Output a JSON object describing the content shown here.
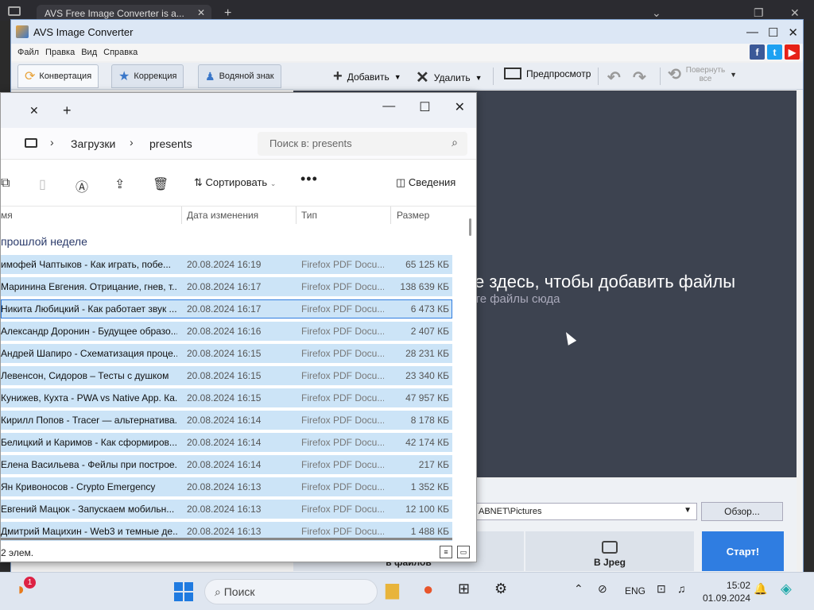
{
  "browser": {
    "tab_title": "AVS Free Image Converter is a...",
    "tab_close": "✕",
    "new_tab": "+",
    "ctrl_chevron": "⌄",
    "ctrl_restore": "❐",
    "ctrl_close": "✕"
  },
  "avs": {
    "title": "AVS Image Converter",
    "menu": [
      "Файл",
      "Правка",
      "Вид",
      "Справка"
    ],
    "social": [
      "f",
      "t",
      "▶"
    ],
    "tabs": [
      "Конвертация",
      "Коррекция",
      "Водяной знак"
    ],
    "toolbar": {
      "add": "Добавить",
      "delete": "Удалить",
      "preview": "Предпросмотр",
      "rotate_line1": "Повернуть",
      "rotate_line2": "все"
    },
    "drop_main": "е здесь, чтобы добавить файлы",
    "drop_sub": "те файлы сюда",
    "output_path": "ABNET\\Pictures",
    "browse": "Обзор...",
    "step1": "в файлов",
    "step2": "В Jpeg",
    "start": "Старт!",
    "colors": {
      "accent": "#2f7de1",
      "drop_bg": "#3d4350"
    }
  },
  "explorer": {
    "breadcrumb": [
      "Загрузки",
      "presents"
    ],
    "search_placeholder": "Поиск в: presents",
    "sort_label": "Сортировать",
    "details_label": "Сведения",
    "more_label": "•••",
    "columns": {
      "name": "мя",
      "date": "Дата изменения",
      "type": "Тип",
      "size": "Размер"
    },
    "group": "прошлой неделе",
    "status": "2 элем.",
    "files": [
      {
        "name": "имофей Чаптыков - Как играть, побе...",
        "date": "20.08.2024 16:19",
        "type": "Firefox PDF Docu...",
        "size": "65 125 КБ"
      },
      {
        "name": "Маринина Евгения. Отрицание, гнев, т...",
        "date": "20.08.2024 16:17",
        "type": "Firefox PDF Docu...",
        "size": "138 639 КБ"
      },
      {
        "name": "Никита Любицкий - Как работает звук ...",
        "date": "20.08.2024 16:17",
        "type": "Firefox PDF Docu...",
        "size": "6 473 КБ"
      },
      {
        "name": "Александр Доронин - Будущее образо...",
        "date": "20.08.2024 16:16",
        "type": "Firefox PDF Docu...",
        "size": "2 407 КБ"
      },
      {
        "name": "Андрей Шапиро - Схематизация проце...",
        "date": "20.08.2024 16:15",
        "type": "Firefox PDF Docu...",
        "size": "28 231 КБ"
      },
      {
        "name": "Левенсон, Сидоров – Тесты с душком",
        "date": "20.08.2024 16:15",
        "type": "Firefox PDF Docu...",
        "size": "23 340 КБ"
      },
      {
        "name": "Кунижев, Кухта - PWA vs Native App. Ка...",
        "date": "20.08.2024 16:15",
        "type": "Firefox PDF Docu...",
        "size": "47 957 КБ"
      },
      {
        "name": "Кирилл Попов - Tracer — альтернатива...",
        "date": "20.08.2024 16:14",
        "type": "Firefox PDF Docu...",
        "size": "8 178 КБ"
      },
      {
        "name": "Белицкий и Каримов - Как сформиров...",
        "date": "20.08.2024 16:14",
        "type": "Firefox PDF Docu...",
        "size": "42 174 КБ"
      },
      {
        "name": "Елена Васильева - Фейлы при построе...",
        "date": "20.08.2024 16:14",
        "type": "Firefox PDF Docu...",
        "size": "217 КБ"
      },
      {
        "name": "Ян Кривоносов - Crypto Emergency",
        "date": "20.08.2024 16:13",
        "type": "Firefox PDF Docu...",
        "size": "1 352 КБ"
      },
      {
        "name": "Евгений Мацюк - Запускаем мобильн...",
        "date": "20.08.2024 16:13",
        "type": "Firefox PDF Docu...",
        "size": "12 100 КБ"
      },
      {
        "name": "Дмитрий Мацихин - Web3 и темные де...",
        "date": "20.08.2024 16:13",
        "type": "Firefox PDF Docu...",
        "size": "1 488 КБ"
      }
    ]
  },
  "taskbar": {
    "search": "Поиск",
    "lang": "ENG",
    "time": "15:02",
    "date": "01.09.2024",
    "notif_count": "1"
  }
}
